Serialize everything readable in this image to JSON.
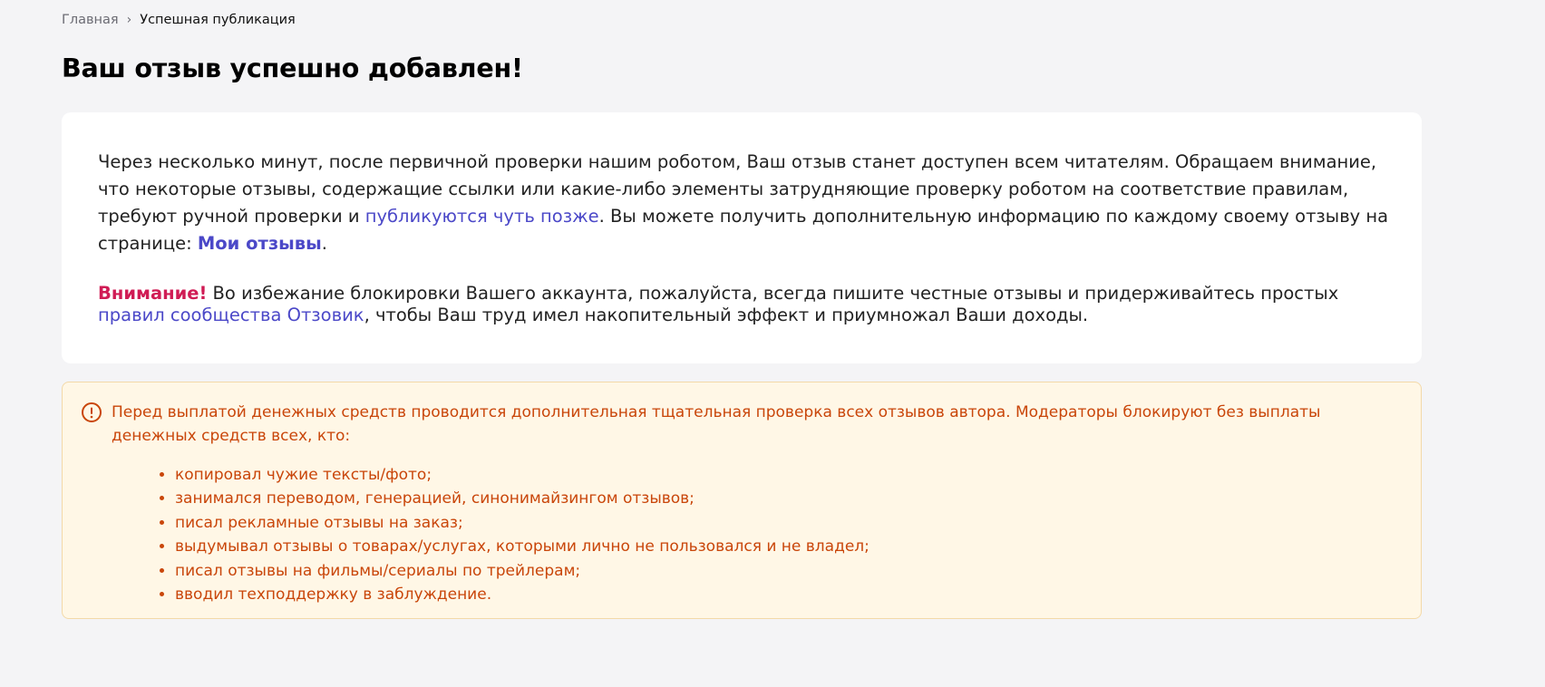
{
  "breadcrumb": {
    "home": "Главная",
    "separator": "›",
    "current": "Успешная публикация"
  },
  "page_title": "Ваш отзыв успешно добавлен!",
  "card": {
    "p1_part1": "Через несколько минут, после первичной проверки нашим роботом, Ваш отзыв станет доступен всем читателям. Обращаем внимание, что некоторые отзывы, содержащие ссылки или какие-либо элементы затрудняющие проверку роботом на соответствие правилам, требуют ручной проверки и ",
    "p1_link": "публикуются чуть позже",
    "p1_part2": ". Вы можете получить дополнительную информацию по каждому своему отзыву на странице: ",
    "p1_strong_link": "Мои отзывы",
    "p1_end": ".",
    "attention_label": "Внимание!",
    "p2_part1": " Во избежание блокировки Вашего аккаунта, пожалуйста, всегда пишите честные отзывы и придерживайтесь простых ",
    "p2_link": "правил сообщества Отзовик",
    "p2_part2": ", чтобы Ваш труд имел накопительный эффект и приумножал Ваши доходы."
  },
  "alert": {
    "icon": "exclamation-circle-icon",
    "text": "Перед выплатой денежных средств проводится дополнительная тщательная проверка всех отзывов автора. Модераторы блокируют без выплаты денежных средств всех, кто:",
    "items": [
      "копировал чужие тексты/фото;",
      "занимался переводом, генерацией, синонимайзингом отзывов;",
      "писал рекламные отзывы на заказ;",
      "выдумывал отзывы о товарах/услугах, которыми лично не пользовался и не владел;",
      "писал отзывы на фильмы/сериалы по трейлерам;",
      "вводил техподдержку в заблуждение."
    ]
  },
  "colors": {
    "link": "#4b48c8",
    "attention": "#d01c55",
    "alert_text": "#c9460a",
    "alert_bg": "#fff7e6"
  }
}
